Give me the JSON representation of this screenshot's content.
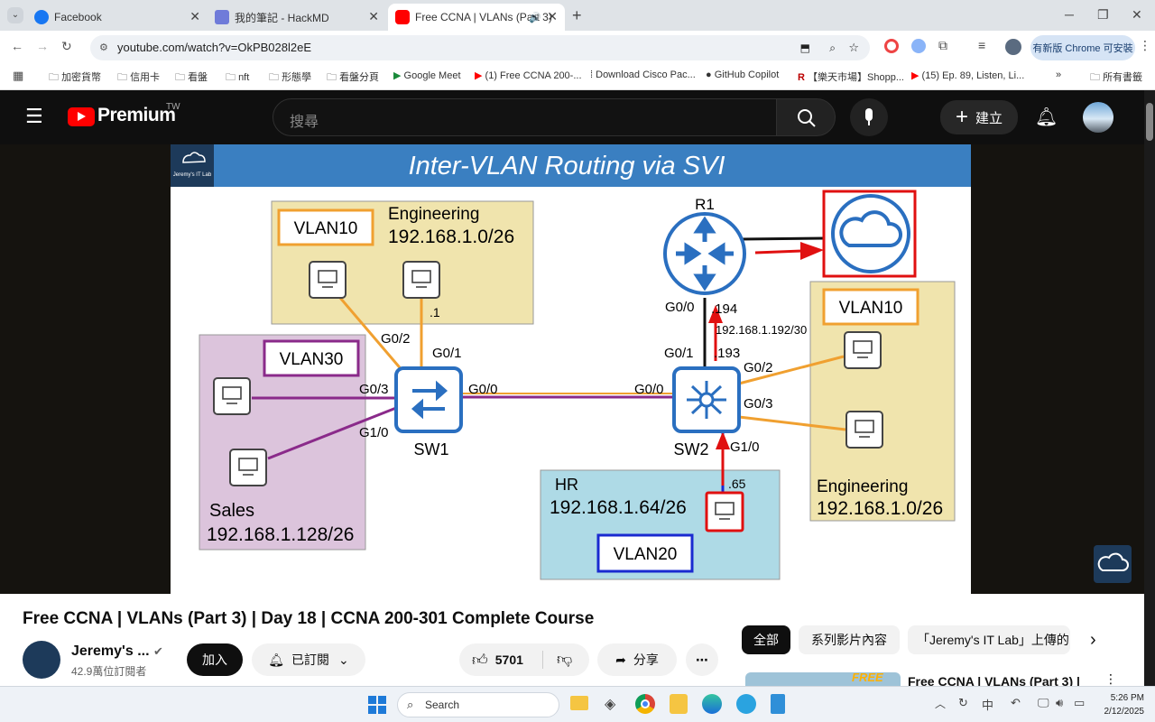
{
  "tabs": [
    {
      "label": "Facebook",
      "color": "#1877f2"
    },
    {
      "label": "我的筆記 - HackMD",
      "color": "#6f7bd9"
    },
    {
      "label": "Free CCNA | VLANs (Part 3)",
      "color": "#ff0000"
    }
  ],
  "url": "youtube.com/watch?v=OkPB028l2eE",
  "update_label": "有新版 Chrome 可安裝",
  "bookmarks": [
    "加密貨幣",
    "信用卡",
    "看盤",
    "nft",
    "形態學",
    "看盤分頁",
    "Google Meet",
    "(1) Free CCNA 200-...",
    "Download Cisco Pac...",
    "GitHub Copilot",
    "【樂天市場】Shopp...",
    "(15) Ep. 89, Listen, Li...",
    "所有書籤"
  ],
  "yt": {
    "logo": "Premium",
    "region": "TW",
    "search_placeholder": "搜尋",
    "create_label": "建立"
  },
  "slide": {
    "title": "Inter-VLAN Routing via SVI",
    "brand": "Jeremy's IT Lab",
    "eng_top": {
      "vlan": "VLAN10",
      "name": "Engineering",
      "net": "192.168.1.0/26",
      "host": ".1"
    },
    "sales": {
      "vlan": "VLAN30",
      "name": "Sales",
      "net": "192.168.1.128/26"
    },
    "eng_right": {
      "vlan": "VLAN10",
      "name": "Engineering",
      "net": "192.168.1.0/26"
    },
    "hr": {
      "vlan": "VLAN20",
      "name": "HR",
      "net": "192.168.1.64/26",
      "host": ".65"
    },
    "r1": {
      "name": "R1",
      "port": "G0/0",
      "ip": ".194",
      "link": "192.168.1.192/30"
    },
    "sw1": {
      "name": "SW1",
      "ports": [
        "G0/2",
        "G0/1",
        "G0/3",
        "G1/0",
        "G0/0"
      ]
    },
    "sw2": {
      "name": "SW2",
      "ports": [
        "G0/1",
        ".193",
        "G0/2",
        "G0/3",
        "G0/0",
        "G1/0"
      ]
    }
  },
  "video_title": "Free CCNA | VLANs (Part 3) | Day 18 | CCNA 200-301 Complete Course",
  "channel": {
    "name": "Jeremy's ...",
    "subs": "42.9萬位訂閱者"
  },
  "join_label": "加入",
  "subscribed_label": "已訂閱",
  "likes": "5701",
  "share_label": "分享",
  "chips": [
    "全部",
    "系列影片內容",
    "「Jeremy's IT Lab」上傳的"
  ],
  "rec_title": "Free CCNA | VLANs (Part 3) |",
  "taskbar": {
    "search": "Search",
    "ime": "中",
    "time": "5:26 PM",
    "date": "2/12/2025"
  }
}
